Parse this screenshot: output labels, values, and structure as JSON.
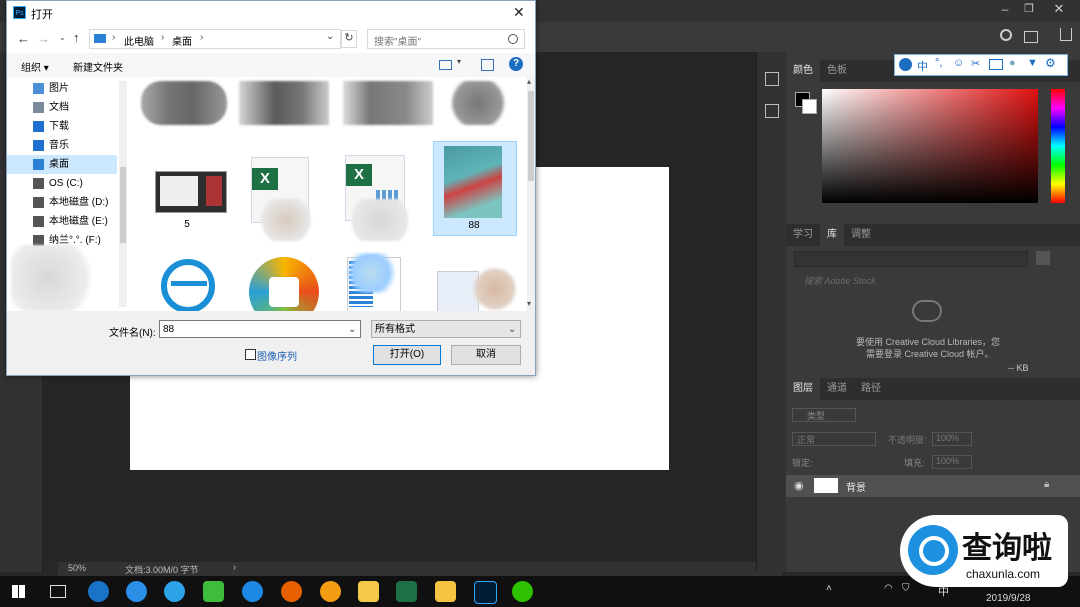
{
  "photoshop": {
    "panels": {
      "color_tabs": [
        "颜色",
        "色板"
      ],
      "lib_tabs": [
        "学习",
        "库",
        "调整"
      ],
      "lib_search_placeholder": "搜索 Adobe Stock",
      "lib_message_1": "要使用 Creative Cloud Libraries，您",
      "lib_message_2": "需要登录 Creative Cloud 帐户。",
      "lib_size": "-- KB",
      "layer_tabs": [
        "图层",
        "通道",
        "路径"
      ],
      "layer_filter": "类型",
      "blend_mode": "正常",
      "opacity_label": "不透明度:",
      "opacity_value": "100%",
      "lock_label": "锁定:",
      "fill_label": "填充:",
      "fill_value": "100%",
      "layer_name": "背景"
    },
    "status": {
      "zoom": "50%",
      "doc_info": "文档:3.00M/0 字节"
    }
  },
  "dialog": {
    "title": "打开",
    "breadcrumb": [
      "此电脑",
      "桌面"
    ],
    "search_placeholder": "搜索\"桌面\"",
    "cmd": {
      "organize": "组织 ▾",
      "new_folder": "新建文件夹"
    },
    "nav_items": [
      {
        "label": "图片",
        "icon": "pictures-icon"
      },
      {
        "label": "文档",
        "icon": "documents-icon"
      },
      {
        "label": "下载",
        "icon": "downloads-icon"
      },
      {
        "label": "音乐",
        "icon": "music-icon"
      },
      {
        "label": "桌面",
        "icon": "desktop-icon",
        "selected": true
      },
      {
        "label": "OS (C:)",
        "icon": "drive-icon"
      },
      {
        "label": "本地磁盘 (D:)",
        "icon": "drive-icon"
      },
      {
        "label": "本地磁盘 (E:)",
        "icon": "drive-icon"
      },
      {
        "label": "纳兰°.°. (F:)",
        "icon": "drive-icon"
      }
    ],
    "files": [
      {
        "name": "5"
      },
      {
        "name": ""
      },
      {
        "name": ""
      },
      {
        "name": "88",
        "selected": true
      }
    ],
    "filename_label": "文件名(N):",
    "filename_value": "88",
    "filetype_value": "所有格式",
    "image_sequence_label": "图像序列",
    "open_button": "打开(O)",
    "cancel_button": "取消"
  },
  "taskbar": {
    "clock": "2019/9/28",
    "ime": "中"
  },
  "watermark": {
    "brand": "查询啦",
    "domain": "chaxunla.com"
  }
}
